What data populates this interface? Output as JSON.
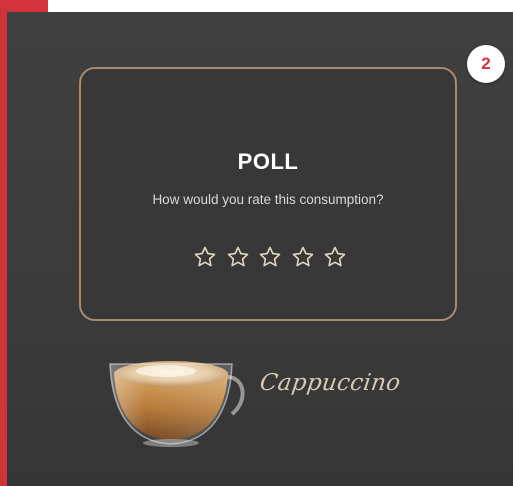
{
  "step_badge": "2",
  "poll": {
    "title": "POLL",
    "question": "How would you rate this consumption?",
    "rating": 0,
    "max_rating": 5,
    "star_icon": "star-outline-icon"
  },
  "product": {
    "name": "Cappuccino",
    "image_icon": "coffee-cup-icon"
  },
  "colors": {
    "accent_red": "#d2323c",
    "card_border": "#a8896d",
    "background": "#3c3c3c"
  }
}
